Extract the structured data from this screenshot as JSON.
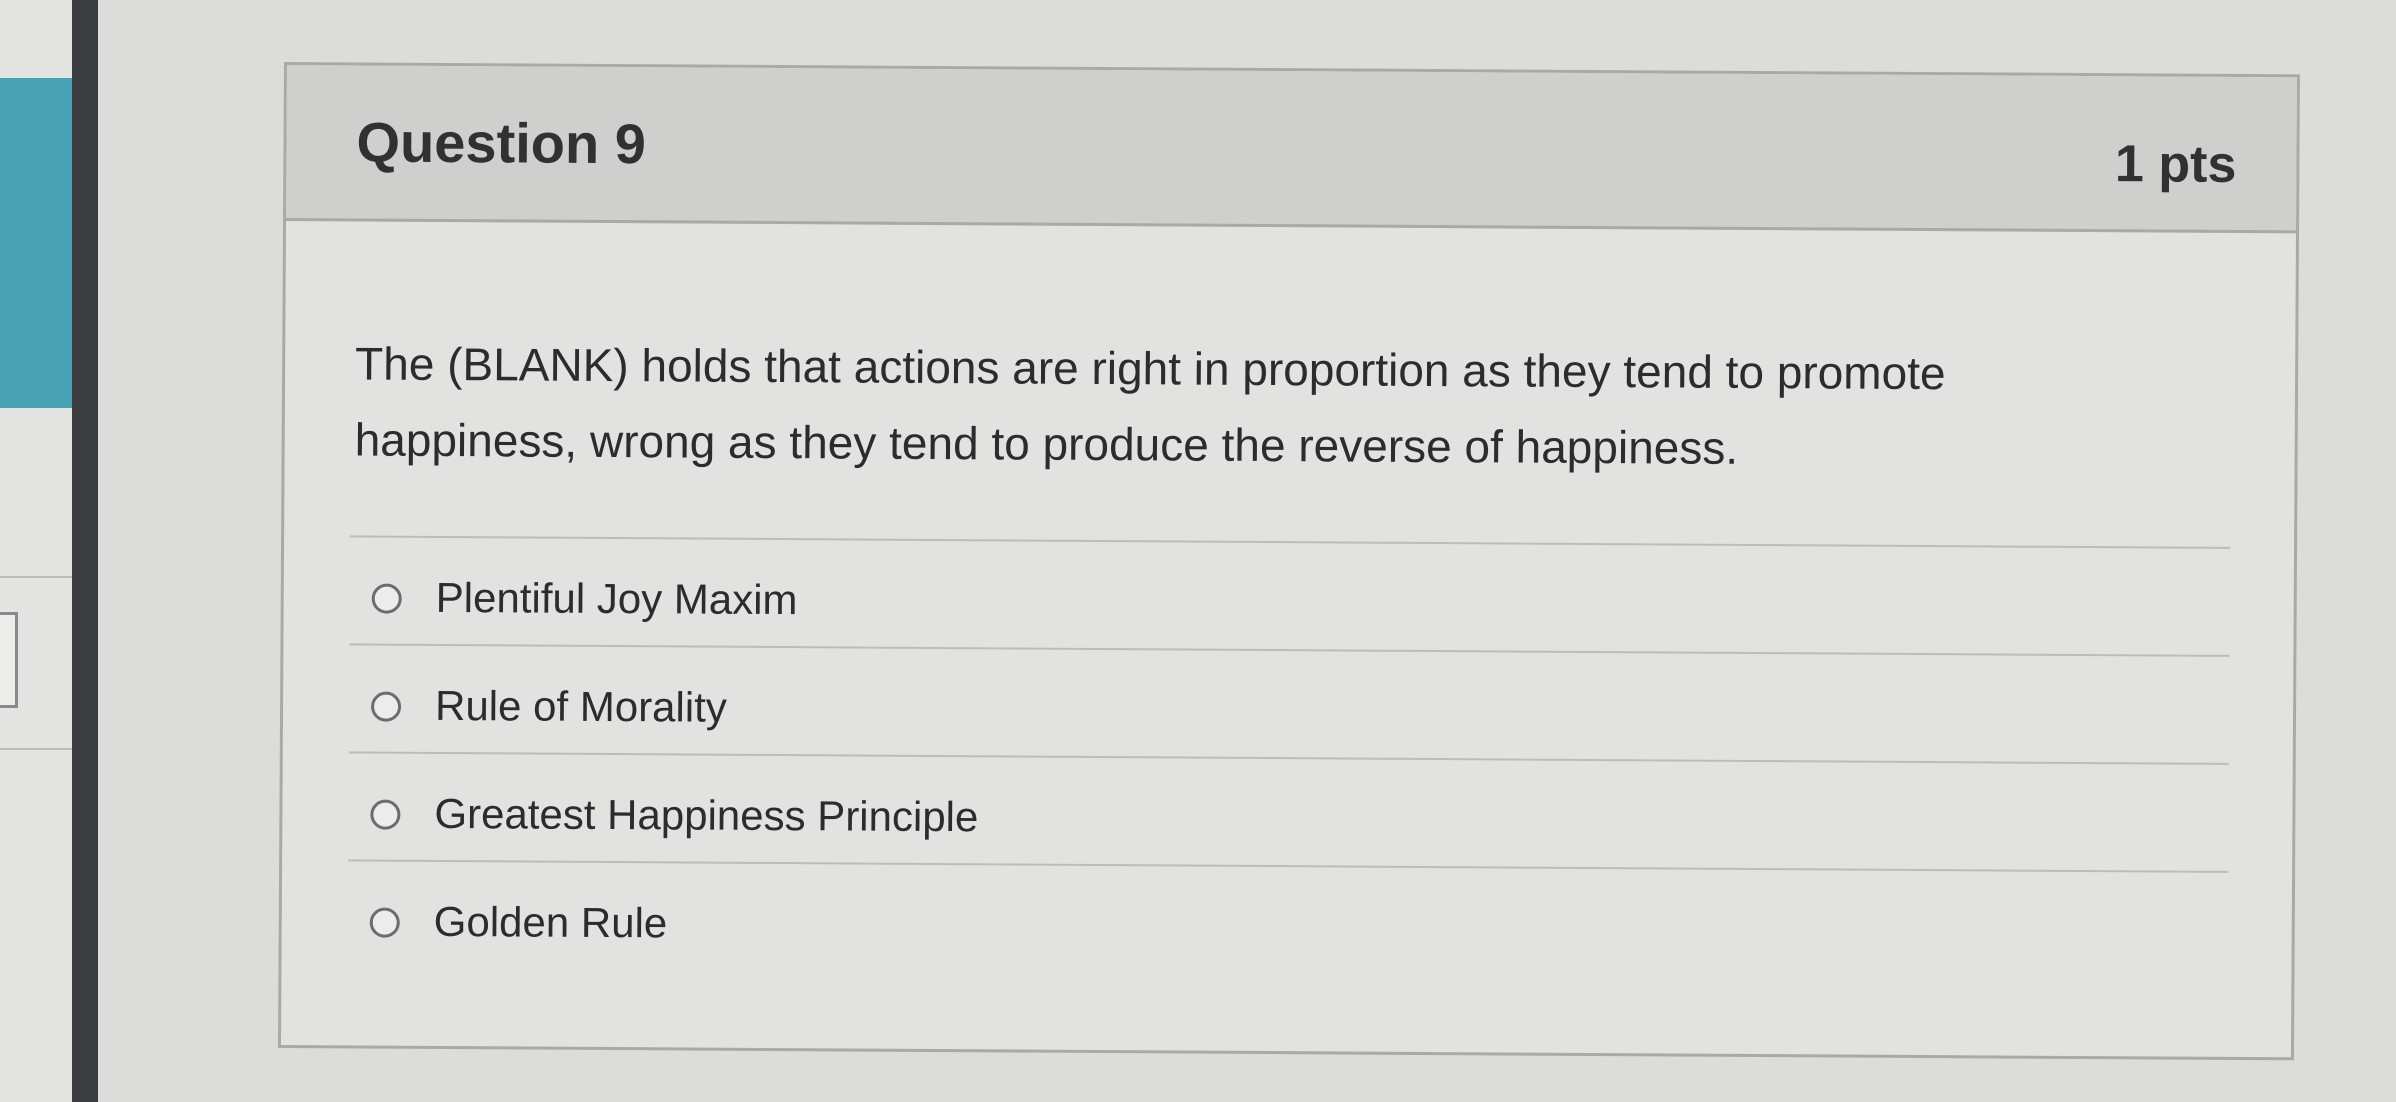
{
  "question": {
    "title": "Question 9",
    "points": "1 pts",
    "text": "The (BLANK) holds that actions are right in proportion as they tend to promote happiness, wrong as they tend to produce the reverse of happiness."
  },
  "answers": [
    {
      "label": "Plentiful Joy Maxim",
      "selected": false
    },
    {
      "label": "Rule of Morality",
      "selected": false
    },
    {
      "label": "Greatest Happiness Principle",
      "selected": false
    },
    {
      "label": "Golden Rule",
      "selected": false
    }
  ],
  "colors": {
    "accent_teal": "#4aa3b5",
    "header_bg": "#cfcfce",
    "text": "#2a2c2e"
  }
}
